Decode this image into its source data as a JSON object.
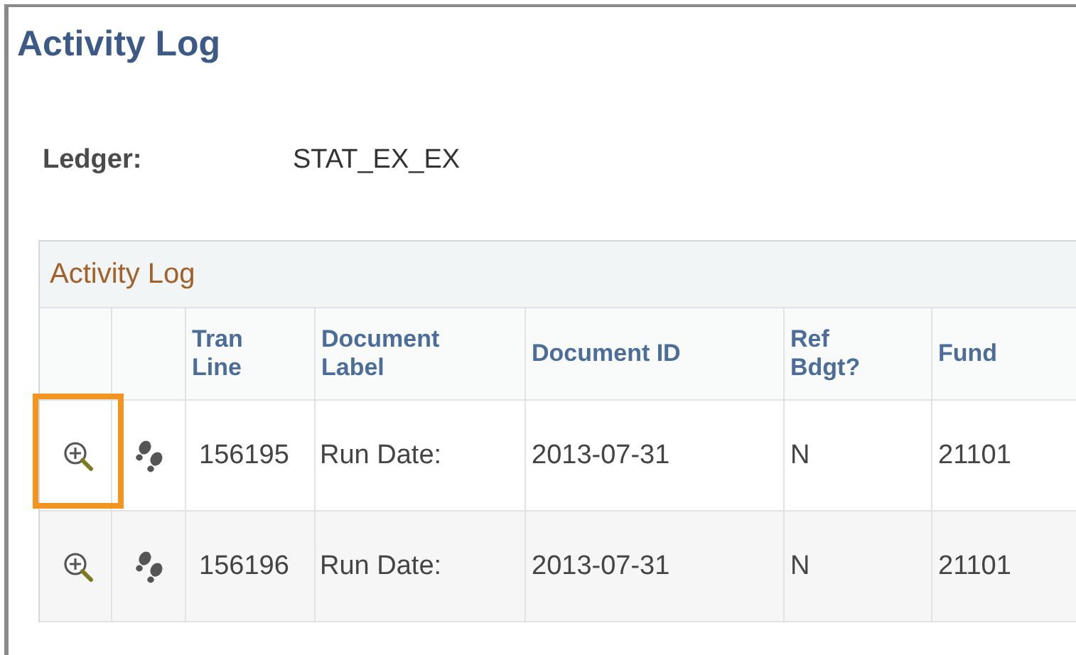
{
  "page_title": "Activity Log",
  "ledger": {
    "label": "Ledger:",
    "value": "STAT_EX_EX"
  },
  "grid": {
    "title": "Activity Log",
    "columns": [
      "",
      "",
      "Tran Line",
      "Document Label",
      "Document ID",
      "Ref Bdgt?",
      "Fund"
    ],
    "rows": [
      {
        "highlighted": true,
        "tran_line": "156195",
        "document_label": "Run Date:",
        "document_id": "2013-07-31",
        "ref_bdgt": "N",
        "fund": "21101"
      },
      {
        "highlighted": false,
        "tran_line": "156196",
        "document_label": "Run Date:",
        "document_id": "2013-07-31",
        "ref_bdgt": "N",
        "fund": "21101"
      }
    ]
  }
}
